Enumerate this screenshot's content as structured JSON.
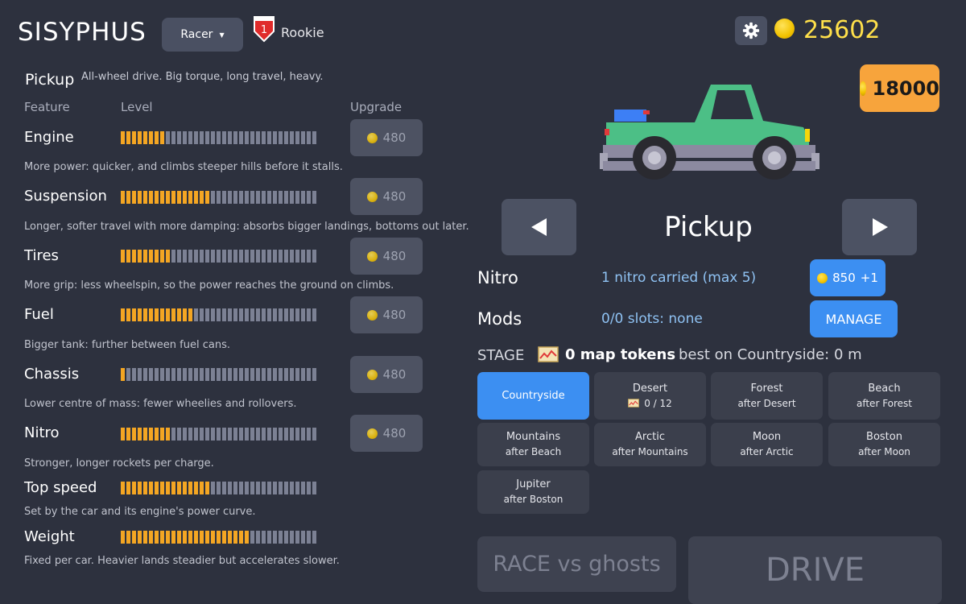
{
  "header": {
    "title": "SISYPHUS",
    "mode_label": "Racer",
    "rank_number": "1",
    "rank_label": "Rookie",
    "coins": "25602"
  },
  "car": {
    "name": "Pickup",
    "description": "All-wheel drive.  Big torque, long travel, heavy.",
    "price": "18000",
    "body_color": "#4cbf86",
    "chassis_color": "#8c8aa0"
  },
  "columns": {
    "feature": "Feature",
    "level": "Level",
    "upgrade": "Upgrade"
  },
  "features": [
    {
      "name": "Engine",
      "level": 8,
      "max": 35,
      "cost": "480",
      "desc": "More power: quicker, and climbs steeper hills before it stalls."
    },
    {
      "name": "Suspension",
      "level": 16,
      "max": 35,
      "cost": "480",
      "desc": "Longer, softer travel with more damping: absorbs bigger landings, bottoms out later."
    },
    {
      "name": "Tires",
      "level": 9,
      "max": 35,
      "cost": "480",
      "desc": "More grip: less wheelspin, so the power reaches the ground on climbs."
    },
    {
      "name": "Fuel",
      "level": 13,
      "max": 35,
      "cost": "480",
      "desc": "Bigger tank: further between fuel cans."
    },
    {
      "name": "Chassis",
      "level": 1,
      "max": 35,
      "cost": "480",
      "desc": "Lower centre of mass: fewer wheelies and rollovers."
    },
    {
      "name": "Nitro",
      "level": 9,
      "max": 35,
      "cost": "480",
      "desc": "Stronger, longer rockets per charge."
    },
    {
      "name": "Top speed",
      "level": 16,
      "max": 35,
      "cost": "",
      "desc": "Set by the car and its engine's power curve."
    },
    {
      "name": "Weight",
      "level": 23,
      "max": 35,
      "cost": "",
      "desc": "Fixed per car. Heavier lands steadier but accelerates slower."
    }
  ],
  "nitro": {
    "label": "Nitro",
    "value": "1 nitro carried (max 5)",
    "buy_cost": "850",
    "buy_amount": "+1"
  },
  "mods": {
    "label": "Mods",
    "value": "0/0 slots: none",
    "manage": "MANAGE"
  },
  "stage": {
    "label": "STAGE",
    "tokens": "0 map tokens",
    "best": "best on Countryside: 0 m",
    "tiles": [
      {
        "name": "Countryside",
        "sub": "",
        "selected": true
      },
      {
        "name": "Desert",
        "sub": "0 / 12",
        "selected": false
      },
      {
        "name": "Forest",
        "sub": "after Desert",
        "selected": false
      },
      {
        "name": "Beach",
        "sub": "after Forest",
        "selected": false
      },
      {
        "name": "Mountains",
        "sub": "after Beach",
        "selected": false
      },
      {
        "name": "Arctic",
        "sub": "after Mountains",
        "selected": false
      },
      {
        "name": "Moon",
        "sub": "after Arctic",
        "selected": false
      },
      {
        "name": "Boston",
        "sub": "after Moon",
        "selected": false
      },
      {
        "name": "Jupiter",
        "sub": "after Boston",
        "selected": false
      }
    ]
  },
  "actions": {
    "race": "RACE vs ghosts",
    "drive": "DRIVE"
  },
  "icons": {
    "settings": "gear-icon",
    "coin": "coin-icon",
    "rank": "rank-shield-icon",
    "prev": "left-arrow-icon",
    "next": "right-arrow-icon",
    "map": "map-token-icon"
  },
  "colors": {
    "background": "#2d313e",
    "accent_blue": "#3c8ff2",
    "bar_fill": "#f4a623",
    "bar_empty": "#7c8194",
    "coin_text": "#ffe04a",
    "price_badge": "#f7a43c"
  }
}
